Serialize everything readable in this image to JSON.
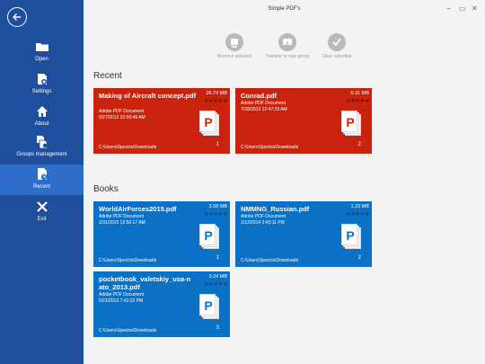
{
  "window": {
    "title": "Simple PDF's",
    "controls": [
      "–",
      "▭",
      "✕"
    ]
  },
  "sidebar": {
    "items": [
      {
        "label": "Open",
        "icon": "folder-icon"
      },
      {
        "label": "Settings",
        "icon": "settings-icon"
      },
      {
        "label": "About",
        "icon": "home-icon"
      },
      {
        "label": "Groups management",
        "icon": "groups-icon"
      },
      {
        "label": "Recent",
        "icon": "recent-icon",
        "active": true
      },
      {
        "label": "Exit",
        "icon": "close-icon"
      }
    ]
  },
  "toolbar": {
    "remove_label": "Remove selected",
    "transfer_label": "Transfer to new group",
    "clear_label": "Clear selection"
  },
  "sections": {
    "recent": "Recent",
    "books": "Books"
  },
  "recent_files": [
    {
      "name": "Making of Aircraft concept.pdf",
      "type": "Adobe PDF Document",
      "date": "5/27/2012 10:50:46 AM",
      "size": "26.74 MB",
      "path": "C:\\Users\\Spectra\\Downloads",
      "count": "1",
      "rating": "★★★★★"
    },
    {
      "name": "Conrad.pdf",
      "type": "Adobe PDF Document",
      "date": "7/28/2013 12:47:29 AM",
      "size": "6.31 MB",
      "path": "C:\\Users\\Spectra\\Downloads",
      "count": "2",
      "rating": "★★★★★"
    }
  ],
  "book_files": [
    {
      "name": "WorldAirForces2015.pdf",
      "type": "Adobe PDF Document",
      "date": "1/31/2015 12:56:17 AM",
      "size": "3.58 MB",
      "path": "C:\\Users\\Spectra\\Downloads",
      "count": "1",
      "rating": "★★★★★"
    },
    {
      "name": "NMMNG_Russian.pdf",
      "type": "Adobe PDF Document",
      "date": "1/12/2014 3:43:11 PM",
      "size": "1.23 MB",
      "path": "C:\\Users\\Spectra\\Downloads",
      "count": "2",
      "rating": "★★★★★"
    },
    {
      "name": "pocketbook_valetskiy_usa-n ato_2013.pdf",
      "type": "Adobe PDF Document",
      "date": "5/21/2013 7:42:22 PM",
      "size": "3.24 MB",
      "path": "C:\\Users\\Spectra\\Downloads",
      "count": "3",
      "rating": "★★★★★"
    }
  ],
  "colors": {
    "sidebar": "#1f4e9c",
    "sidebar_active": "#2e6dc8",
    "recent_tile": "#c9230d",
    "book_tile": "#0a71c5"
  }
}
